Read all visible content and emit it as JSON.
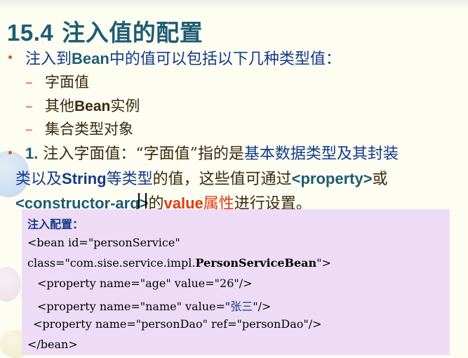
{
  "title": {
    "number": "15.4",
    "text": "注入值的配置"
  },
  "bullet1": {
    "pre": "注入到",
    "en": "Bean",
    "post": "中的值可以包括以下几种类型值："
  },
  "sub_items": [
    {
      "dash": "–",
      "pre": "字面值",
      "en": "",
      "post": ""
    },
    {
      "dash": "–",
      "pre": "其他",
      "en": "Bean",
      "post": "实例"
    },
    {
      "dash": "–",
      "pre": "集合类型对象",
      "en": "",
      "post": ""
    }
  ],
  "bullet2": {
    "line1": {
      "num": "1.",
      "a": "注入字面值：",
      "b": "“字面值”指的是",
      "c": "基本数据类型及其封装"
    },
    "line2": {
      "a": "类以及",
      "b": "String",
      "c": "等类型",
      "d": "的值，这些值可通过",
      "e": "<property>",
      "f": "或"
    },
    "line3": {
      "a": "<constructor-arg>",
      "b": "的",
      "c": "value",
      "d": "属性",
      "e": "进行设置。"
    }
  },
  "code": {
    "title": "注入配置：",
    "line1": "<bean id=\"personService\"",
    "line2_pre": "class=\"com.sise.service.impl.",
    "line2_bold": "PersonServiceBean",
    "line2_post": "\">",
    "line3": "<property name=\"age\" value=\"26\"/>",
    "line4_pre": "<property name=\"name\" value=\"",
    "line4_val": "张三",
    "line4_post": "\"/>",
    "line5": "<property name=\"personDao\" ref=\"personDao\"/>",
    "line6": "</bean>"
  },
  "colors": {
    "title": "#1d5c74",
    "bullet": "#e05a10",
    "code_bg": "#eedcf6",
    "highlight": "#e03a10"
  }
}
